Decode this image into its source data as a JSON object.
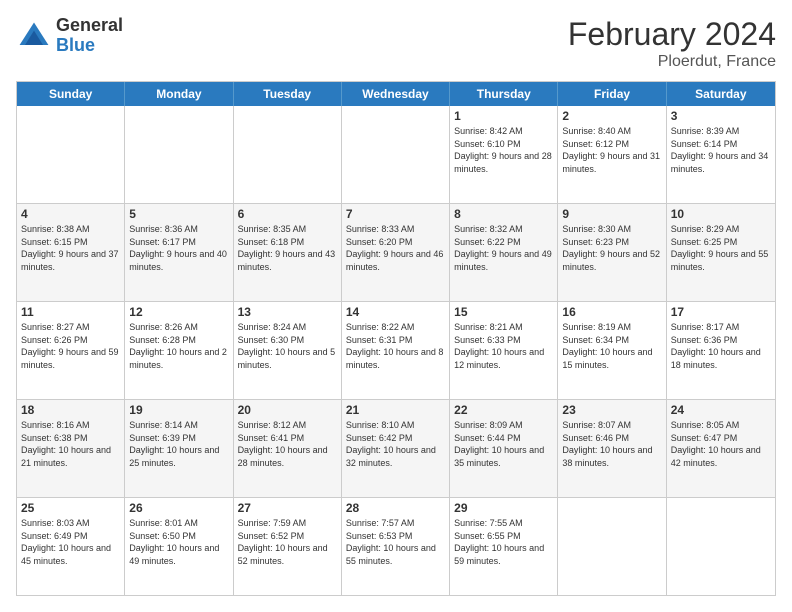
{
  "header": {
    "logo_general": "General",
    "logo_blue": "Blue",
    "title": "February 2024",
    "subtitle": "Ploerdut, France"
  },
  "calendar": {
    "weekdays": [
      "Sunday",
      "Monday",
      "Tuesday",
      "Wednesday",
      "Thursday",
      "Friday",
      "Saturday"
    ],
    "rows": [
      [
        {
          "day": "",
          "info": ""
        },
        {
          "day": "",
          "info": ""
        },
        {
          "day": "",
          "info": ""
        },
        {
          "day": "",
          "info": ""
        },
        {
          "day": "1",
          "info": "Sunrise: 8:42 AM\nSunset: 6:10 PM\nDaylight: 9 hours and 28 minutes."
        },
        {
          "day": "2",
          "info": "Sunrise: 8:40 AM\nSunset: 6:12 PM\nDaylight: 9 hours and 31 minutes."
        },
        {
          "day": "3",
          "info": "Sunrise: 8:39 AM\nSunset: 6:14 PM\nDaylight: 9 hours and 34 minutes."
        }
      ],
      [
        {
          "day": "4",
          "info": "Sunrise: 8:38 AM\nSunset: 6:15 PM\nDaylight: 9 hours and 37 minutes."
        },
        {
          "day": "5",
          "info": "Sunrise: 8:36 AM\nSunset: 6:17 PM\nDaylight: 9 hours and 40 minutes."
        },
        {
          "day": "6",
          "info": "Sunrise: 8:35 AM\nSunset: 6:18 PM\nDaylight: 9 hours and 43 minutes."
        },
        {
          "day": "7",
          "info": "Sunrise: 8:33 AM\nSunset: 6:20 PM\nDaylight: 9 hours and 46 minutes."
        },
        {
          "day": "8",
          "info": "Sunrise: 8:32 AM\nSunset: 6:22 PM\nDaylight: 9 hours and 49 minutes."
        },
        {
          "day": "9",
          "info": "Sunrise: 8:30 AM\nSunset: 6:23 PM\nDaylight: 9 hours and 52 minutes."
        },
        {
          "day": "10",
          "info": "Sunrise: 8:29 AM\nSunset: 6:25 PM\nDaylight: 9 hours and 55 minutes."
        }
      ],
      [
        {
          "day": "11",
          "info": "Sunrise: 8:27 AM\nSunset: 6:26 PM\nDaylight: 9 hours and 59 minutes."
        },
        {
          "day": "12",
          "info": "Sunrise: 8:26 AM\nSunset: 6:28 PM\nDaylight: 10 hours and 2 minutes."
        },
        {
          "day": "13",
          "info": "Sunrise: 8:24 AM\nSunset: 6:30 PM\nDaylight: 10 hours and 5 minutes."
        },
        {
          "day": "14",
          "info": "Sunrise: 8:22 AM\nSunset: 6:31 PM\nDaylight: 10 hours and 8 minutes."
        },
        {
          "day": "15",
          "info": "Sunrise: 8:21 AM\nSunset: 6:33 PM\nDaylight: 10 hours and 12 minutes."
        },
        {
          "day": "16",
          "info": "Sunrise: 8:19 AM\nSunset: 6:34 PM\nDaylight: 10 hours and 15 minutes."
        },
        {
          "day": "17",
          "info": "Sunrise: 8:17 AM\nSunset: 6:36 PM\nDaylight: 10 hours and 18 minutes."
        }
      ],
      [
        {
          "day": "18",
          "info": "Sunrise: 8:16 AM\nSunset: 6:38 PM\nDaylight: 10 hours and 21 minutes."
        },
        {
          "day": "19",
          "info": "Sunrise: 8:14 AM\nSunset: 6:39 PM\nDaylight: 10 hours and 25 minutes."
        },
        {
          "day": "20",
          "info": "Sunrise: 8:12 AM\nSunset: 6:41 PM\nDaylight: 10 hours and 28 minutes."
        },
        {
          "day": "21",
          "info": "Sunrise: 8:10 AM\nSunset: 6:42 PM\nDaylight: 10 hours and 32 minutes."
        },
        {
          "day": "22",
          "info": "Sunrise: 8:09 AM\nSunset: 6:44 PM\nDaylight: 10 hours and 35 minutes."
        },
        {
          "day": "23",
          "info": "Sunrise: 8:07 AM\nSunset: 6:46 PM\nDaylight: 10 hours and 38 minutes."
        },
        {
          "day": "24",
          "info": "Sunrise: 8:05 AM\nSunset: 6:47 PM\nDaylight: 10 hours and 42 minutes."
        }
      ],
      [
        {
          "day": "25",
          "info": "Sunrise: 8:03 AM\nSunset: 6:49 PM\nDaylight: 10 hours and 45 minutes."
        },
        {
          "day": "26",
          "info": "Sunrise: 8:01 AM\nSunset: 6:50 PM\nDaylight: 10 hours and 49 minutes."
        },
        {
          "day": "27",
          "info": "Sunrise: 7:59 AM\nSunset: 6:52 PM\nDaylight: 10 hours and 52 minutes."
        },
        {
          "day": "28",
          "info": "Sunrise: 7:57 AM\nSunset: 6:53 PM\nDaylight: 10 hours and 55 minutes."
        },
        {
          "day": "29",
          "info": "Sunrise: 7:55 AM\nSunset: 6:55 PM\nDaylight: 10 hours and 59 minutes."
        },
        {
          "day": "",
          "info": ""
        },
        {
          "day": "",
          "info": ""
        }
      ]
    ]
  }
}
